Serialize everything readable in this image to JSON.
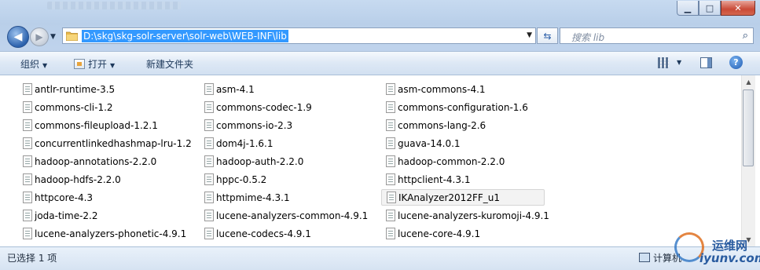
{
  "titlebar": {
    "controls": {
      "minimize": "▁",
      "maximize": "□",
      "close": "✕"
    }
  },
  "nav": {
    "back_glyph": "◀",
    "forward_glyph": "▶",
    "history_glyph": "▼",
    "address": "D:\\skg\\skg-solr-server\\solr-web\\WEB-INF\\lib",
    "address_dropdown": "▼",
    "refresh_glyph": "⇆",
    "search_placeholder": "搜索 lib",
    "search_glyph": "⌕"
  },
  "toolbar": {
    "organize": "组织",
    "open": "打开",
    "new_folder": "新建文件夹",
    "arrow": "▼",
    "help": "?"
  },
  "files": {
    "col1": [
      "antlr-runtime-3.5",
      "commons-cli-1.2",
      "commons-fileupload-1.2.1",
      "concurrentlinkedhashmap-lru-1.2",
      "hadoop-annotations-2.2.0",
      "hadoop-hdfs-2.2.0",
      "httpcore-4.3",
      "joda-time-2.2",
      "lucene-analyzers-phonetic-4.9.1"
    ],
    "col2": [
      "asm-4.1",
      "commons-codec-1.9",
      "commons-io-2.3",
      "dom4j-1.6.1",
      "hadoop-auth-2.2.0",
      "hppc-0.5.2",
      "httpmime-4.3.1",
      "lucene-analyzers-common-4.9.1",
      "lucene-codecs-4.9.1"
    ],
    "col3": [
      "asm-commons-4.1",
      "commons-configuration-1.6",
      "commons-lang-2.6",
      "guava-14.0.1",
      "hadoop-common-2.2.0",
      "httpclient-4.3.1",
      "IKAnalyzer2012FF_u1",
      "lucene-analyzers-kuromoji-4.9.1",
      "lucene-core-4.9.1"
    ],
    "selected": "IKAnalyzer2012FF_u1"
  },
  "scrollbar": {
    "up": "▲",
    "down": "▼"
  },
  "status": {
    "selection": "已选择 1 项",
    "location": "计算机"
  },
  "watermark": {
    "cn": "运维网",
    "en": "iyunv.com"
  }
}
